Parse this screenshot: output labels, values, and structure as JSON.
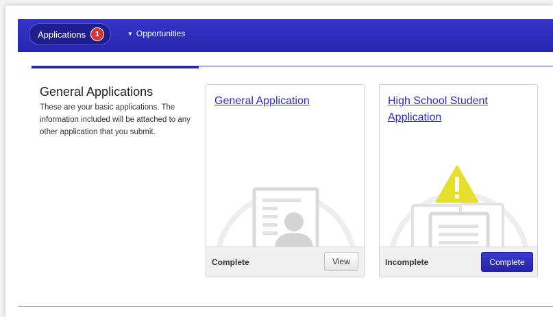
{
  "nav": {
    "applications_label": "Applications",
    "applications_badge": "1",
    "opportunities_label": "Opportunities",
    "caret_icon": "triangle-down"
  },
  "section": {
    "title": "General Applications",
    "description": "These are your basic applications. The information included will be attached to any other application that you submit."
  },
  "cards": [
    {
      "title": "General Application",
      "status": "Complete",
      "action_label": "View",
      "icon": "profile-document-icon"
    },
    {
      "title": "High School Student Application",
      "status": "Incomplete",
      "action_label": "Complete",
      "icon": "warning-documents-icon"
    }
  ],
  "colors": {
    "nav_bg": "#2d2dbf",
    "badge": "#e0312f",
    "link": "#2a2ad0",
    "warning": "#e6e02a",
    "primary_button": "#2a2ab8"
  }
}
